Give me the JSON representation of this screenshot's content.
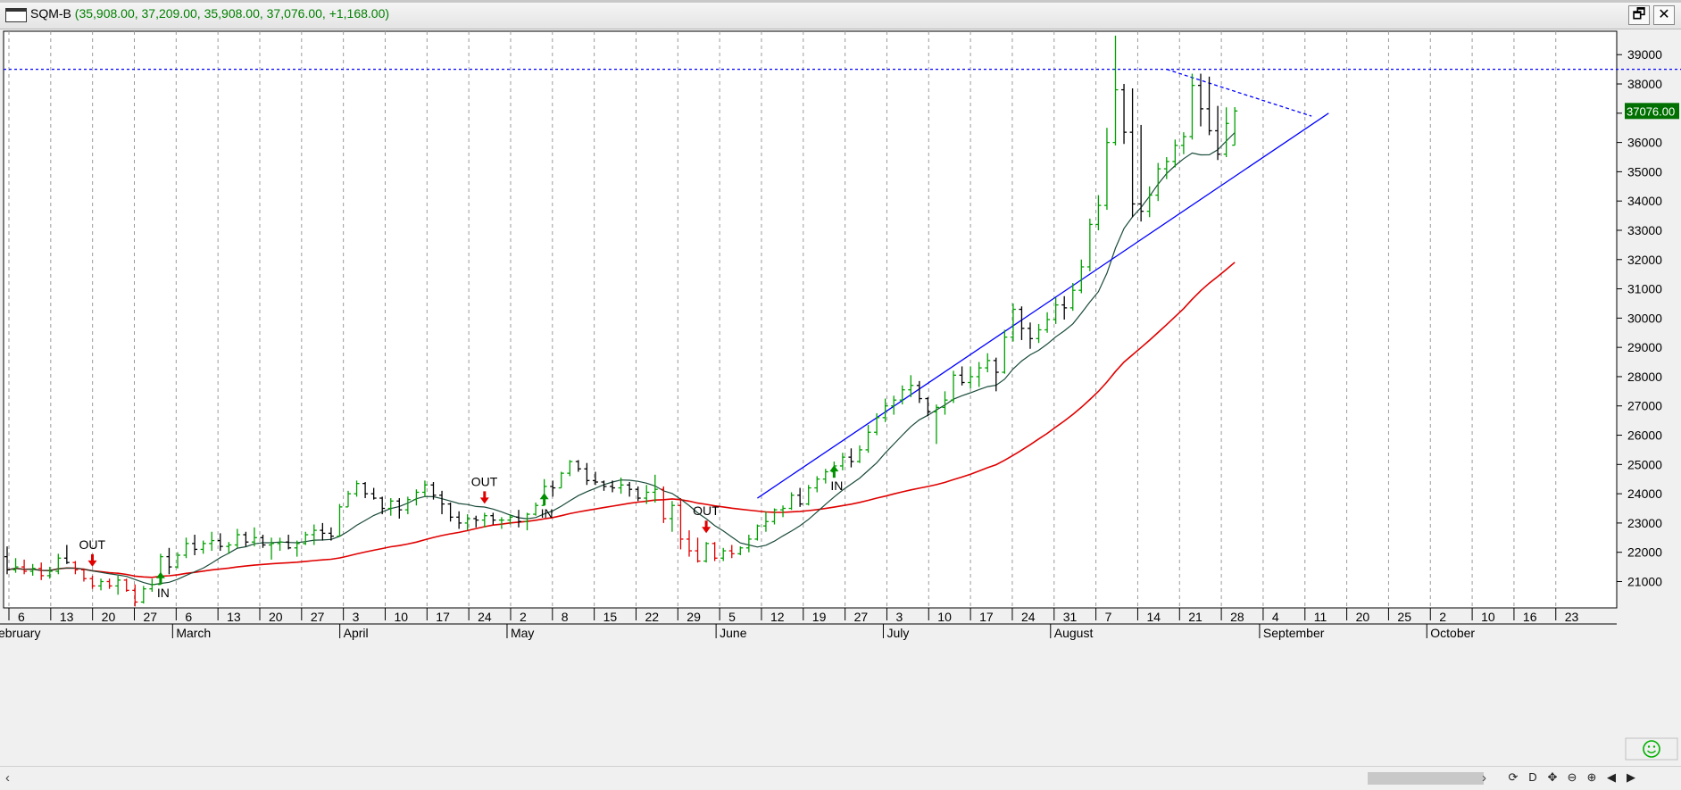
{
  "window": {
    "symbol": "SQM-B",
    "quote": "(35,908.00, 37,209.00, 35,908.00, 37,076.00, +1,168.00)",
    "restore_glyph": "🗗",
    "close_glyph": "✕"
  },
  "colors": {
    "up": "#00a000",
    "down": "#000000",
    "ma_fast": "#1a4a3a",
    "ma_slow": "#e00000",
    "trend": "#0000ff",
    "last_price_bg": "#007000",
    "signal_out": "#e00000",
    "signal_in": "#009000"
  },
  "chart_data": {
    "type": "ohlc",
    "symbol": "SQM-B",
    "last_price_label": "37076.00",
    "y_ticks": [
      21000,
      22000,
      23000,
      24000,
      25000,
      26000,
      27000,
      28000,
      29000,
      30000,
      31000,
      32000,
      33000,
      34000,
      35000,
      36000,
      37000,
      38000,
      39000
    ],
    "ylim": [
      20100,
      39800
    ],
    "x_tick_labels": [
      "6",
      "13",
      "20",
      "27",
      "6",
      "13",
      "20",
      "27",
      "3",
      "10",
      "17",
      "24",
      "2",
      "8",
      "15",
      "22",
      "29",
      "5",
      "12",
      "19",
      "27",
      "3",
      "10",
      "17",
      "24",
      "31",
      "7",
      "14",
      "21",
      "28",
      "4",
      "11",
      "20",
      "25",
      "2",
      "10",
      "16",
      "23"
    ],
    "month_labels": [
      "ebruary",
      "March",
      "April",
      "May",
      "June",
      "July",
      "August",
      "September",
      "October"
    ],
    "month_start_tick_index": [
      0,
      4,
      8,
      12,
      17,
      21,
      25,
      30,
      34
    ],
    "resistance_level": 38500,
    "bars": [
      [
        21850,
        22200,
        21250,
        21400
      ],
      [
        21400,
        21800,
        21300,
        21500
      ],
      [
        21500,
        21750,
        21250,
        21350
      ],
      [
        21350,
        21600,
        21200,
        21450
      ],
      [
        21450,
        21650,
        21050,
        21200
      ],
      [
        21200,
        21500,
        21100,
        21350
      ],
      [
        21350,
        21950,
        21250,
        21800
      ],
      [
        21800,
        22250,
        21600,
        21650
      ],
      [
        21650,
        21700,
        21250,
        21400
      ],
      [
        21400,
        21450,
        21000,
        21100
      ],
      [
        21100,
        21200,
        20750,
        20850
      ],
      [
        20850,
        21100,
        20700,
        21000
      ],
      [
        21000,
        21100,
        20750,
        20850
      ],
      [
        20850,
        21200,
        20550,
        21050
      ],
      [
        21050,
        21100,
        20650,
        20700
      ],
      [
        20700,
        20900,
        20150,
        20300
      ],
      [
        20300,
        20850,
        20250,
        20750
      ],
      [
        20750,
        21100,
        20650,
        20900
      ],
      [
        20900,
        21950,
        20900,
        21850
      ],
      [
        21850,
        22150,
        21250,
        21500
      ],
      [
        21500,
        22000,
        21450,
        21900
      ],
      [
        21900,
        22500,
        21800,
        22300
      ],
      [
        22300,
        22600,
        21900,
        22100
      ],
      [
        22100,
        22400,
        21950,
        22300
      ],
      [
        22300,
        22700,
        22050,
        22400
      ],
      [
        22400,
        22650,
        22050,
        22200
      ],
      [
        22200,
        22350,
        21950,
        22250
      ],
      [
        22250,
        22800,
        22150,
        22600
      ],
      [
        22600,
        22700,
        22200,
        22350
      ],
      [
        22350,
        22850,
        22200,
        22500
      ],
      [
        22500,
        22600,
        22150,
        22250
      ],
      [
        22250,
        22500,
        21750,
        22300
      ],
      [
        22300,
        22500,
        22050,
        22350
      ],
      [
        22350,
        22600,
        22100,
        22150
      ],
      [
        22150,
        22400,
        21850,
        22300
      ],
      [
        22300,
        22700,
        22250,
        22600
      ],
      [
        22600,
        22950,
        22250,
        22750
      ],
      [
        22750,
        23000,
        22400,
        22650
      ],
      [
        22650,
        22850,
        22400,
        22550
      ],
      [
        22550,
        23650,
        22550,
        23550
      ],
      [
        23550,
        24100,
        23550,
        24000
      ],
      [
        24000,
        24450,
        23900,
        24350
      ],
      [
        24350,
        24400,
        23850,
        24000
      ],
      [
        24000,
        24200,
        23800,
        23850
      ],
      [
        23850,
        23900,
        23300,
        23500
      ],
      [
        23500,
        23850,
        23250,
        23750
      ],
      [
        23750,
        23850,
        23150,
        23450
      ],
      [
        23450,
        23900,
        23300,
        23800
      ],
      [
        23800,
        24150,
        23600,
        24050
      ],
      [
        24050,
        24450,
        23900,
        24300
      ],
      [
        24300,
        24400,
        23800,
        23950
      ],
      [
        23950,
        24100,
        23300,
        23650
      ],
      [
        23650,
        23700,
        23050,
        23200
      ],
      [
        23200,
        23400,
        22800,
        23000
      ],
      [
        23000,
        23300,
        22750,
        23150
      ],
      [
        23150,
        23250,
        22850,
        23100
      ],
      [
        23100,
        23350,
        22850,
        23250
      ],
      [
        23250,
        23350,
        22950,
        23100
      ],
      [
        23100,
        23200,
        22800,
        23100
      ],
      [
        23100,
        23300,
        22950,
        23200
      ],
      [
        23200,
        23450,
        22850,
        23050
      ],
      [
        23050,
        23350,
        22750,
        23300
      ],
      [
        23300,
        23700,
        23250,
        23600
      ],
      [
        23600,
        24500,
        23600,
        24250
      ],
      [
        24250,
        24450,
        23900,
        24200
      ],
      [
        24200,
        24750,
        24200,
        24700
      ],
      [
        24700,
        25150,
        24600,
        25100
      ],
      [
        25100,
        25150,
        24750,
        24850
      ],
      [
        24850,
        25050,
        24300,
        24450
      ],
      [
        24450,
        24750,
        24300,
        24400
      ],
      [
        24400,
        24450,
        24100,
        24250
      ],
      [
        24250,
        24450,
        24050,
        24200
      ],
      [
        24200,
        24550,
        24000,
        24300
      ],
      [
        24300,
        24400,
        23900,
        24150
      ],
      [
        24150,
        24250,
        23750,
        23850
      ],
      [
        23850,
        24300,
        23650,
        24050
      ],
      [
        24050,
        24650,
        23700,
        24150
      ],
      [
        24150,
        24250,
        23000,
        23150
      ],
      [
        23150,
        23750,
        22700,
        23600
      ],
      [
        23600,
        23850,
        22100,
        22450
      ],
      [
        22450,
        22750,
        21850,
        22050
      ],
      [
        22050,
        22500,
        21650,
        21700
      ],
      [
        21700,
        22350,
        21650,
        22300
      ],
      [
        22300,
        22350,
        21700,
        21800
      ],
      [
        21800,
        22150,
        21700,
        22050
      ],
      [
        22050,
        22250,
        21800,
        21950
      ],
      [
        21950,
        22200,
        21900,
        22150
      ],
      [
        22150,
        22600,
        22000,
        22450
      ],
      [
        22450,
        22950,
        22400,
        22900
      ],
      [
        22900,
        23400,
        22700,
        23050
      ],
      [
        23050,
        23500,
        22950,
        23450
      ],
      [
        23450,
        23600,
        23200,
        23500
      ],
      [
        23500,
        24050,
        23450,
        23950
      ],
      [
        23950,
        24200,
        23550,
        23650
      ],
      [
        23650,
        24300,
        23600,
        24200
      ],
      [
        24200,
        24600,
        24050,
        24500
      ],
      [
        24500,
        24850,
        24350,
        24750
      ],
      [
        24750,
        25100,
        24550,
        24950
      ],
      [
        24950,
        25400,
        24800,
        25250
      ],
      [
        25250,
        25550,
        24900,
        25100
      ],
      [
        25100,
        25650,
        25050,
        25500
      ],
      [
        25500,
        26350,
        25400,
        26100
      ],
      [
        26100,
        26750,
        26000,
        26600
      ],
      [
        26600,
        27250,
        26450,
        27000
      ],
      [
        27000,
        27350,
        26700,
        27200
      ],
      [
        27200,
        27700,
        27050,
        27550
      ],
      [
        27550,
        28050,
        27300,
        27700
      ],
      [
        27700,
        27850,
        27100,
        27250
      ],
      [
        27250,
        27300,
        26650,
        26800
      ],
      [
        26800,
        27050,
        25700,
        26950
      ],
      [
        26950,
        27500,
        26700,
        27200
      ],
      [
        27200,
        28200,
        27100,
        28050
      ],
      [
        28050,
        28350,
        27700,
        27800
      ],
      [
        27800,
        28350,
        27600,
        28000
      ],
      [
        28000,
        28500,
        27650,
        28300
      ],
      [
        28300,
        28800,
        28150,
        28550
      ],
      [
        28550,
        28650,
        27500,
        28150
      ],
      [
        28150,
        29600,
        28100,
        29350
      ],
      [
        29350,
        30500,
        29200,
        30300
      ],
      [
        30300,
        30400,
        29250,
        29650
      ],
      [
        29650,
        29850,
        28950,
        29300
      ],
      [
        29300,
        29800,
        29150,
        29600
      ],
      [
        29600,
        30200,
        29500,
        29950
      ],
      [
        29950,
        30700,
        29800,
        30450
      ],
      [
        30450,
        30750,
        29950,
        30350
      ],
      [
        30350,
        31200,
        30250,
        30950
      ],
      [
        30950,
        32000,
        30850,
        31750
      ],
      [
        31750,
        33400,
        31600,
        33200
      ],
      [
        33200,
        34200,
        33000,
        33850
      ],
      [
        33850,
        36500,
        33700,
        36000
      ],
      [
        36000,
        39650,
        35900,
        37800
      ],
      [
        37800,
        38000,
        35950,
        36350
      ],
      [
        36350,
        37850,
        33450,
        33900
      ],
      [
        33900,
        36600,
        33300,
        33650
      ],
      [
        33650,
        34500,
        33450,
        34200
      ],
      [
        34200,
        35300,
        34000,
        35100
      ],
      [
        35100,
        35500,
        34750,
        35350
      ],
      [
        35350,
        36100,
        35150,
        35900
      ],
      [
        35900,
        36350,
        35600,
        36200
      ],
      [
        36200,
        38350,
        36100,
        37950
      ],
      [
        37950,
        38350,
        36550,
        37150
      ],
      [
        37150,
        38250,
        36250,
        36400
      ],
      [
        36400,
        37250,
        35400,
        35600
      ],
      [
        35600,
        37200,
        35500,
        36650
      ],
      [
        35908,
        37209,
        35908,
        37076
      ]
    ],
    "ma_fast_note": "short moving average",
    "signals": [
      {
        "type": "OUT",
        "bar": 10
      },
      {
        "type": "IN",
        "bar": 18
      },
      {
        "type": "OUT",
        "bar": 56
      },
      {
        "type": "IN",
        "bar": 63
      },
      {
        "type": "OUT",
        "bar": 82
      },
      {
        "type": "IN",
        "bar": 97
      }
    ],
    "signal_labels": {
      "out": "OUT",
      "in": "IN"
    },
    "trend_lines": [
      {
        "style": "solid",
        "from": {
          "bar": 88,
          "price": 23850
        },
        "to": {
          "bar": 155,
          "price": 37000
        }
      },
      {
        "style": "dashed",
        "from": {
          "bar": 136,
          "price": 38500
        },
        "to": {
          "bar": 153,
          "price": 36900
        }
      }
    ]
  },
  "scrollbar": {
    "left_glyph": "‹",
    "right_glyph": "›"
  },
  "toolbar": {
    "buttons": [
      "⟳",
      "D",
      "✥",
      "⊖",
      "⊕",
      "◀",
      "▶"
    ]
  }
}
